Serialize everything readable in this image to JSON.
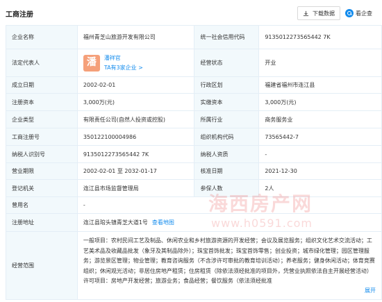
{
  "header": {
    "title": "工商注册",
    "download_label": "下载数据",
    "report_label": "看企查"
  },
  "fields": {
    "company_name": {
      "label": "企业名称",
      "value": "福州青芝山旅游开发有限公司"
    },
    "credit_code": {
      "label": "统一社会信用代码",
      "value": "9135012273565442 7K"
    },
    "legal_rep": {
      "label": "法定代表人",
      "avatar_char": "潘",
      "name": "潘祥官",
      "tag": "TA有3家企业 >"
    },
    "status": {
      "label": "经营状态",
      "value": "开业"
    },
    "found_date": {
      "label": "成立日期",
      "value": "2002-02-01"
    },
    "region": {
      "label": "行政区划",
      "value": "福建省福州市连江县"
    },
    "reg_capital": {
      "label": "注册资本",
      "value": "3,000万(元)"
    },
    "paid_capital": {
      "label": "实缴资本",
      "value": "3,000万(元)"
    },
    "company_type": {
      "label": "企业类型",
      "value": "有限责任公司(自然人投资或控股)"
    },
    "industry": {
      "label": "所属行业",
      "value": "商务服务业"
    },
    "reg_no": {
      "label": "工商注册号",
      "value": "350122100004986"
    },
    "org_code": {
      "label": "组织机构代码",
      "value": "73565442-7"
    },
    "taxpayer_id": {
      "label": "纳税人识别号",
      "value": "9135012273565442 7K"
    },
    "taxpayer_qual": {
      "label": "纳税人资质",
      "value": "-"
    },
    "biz_term": {
      "label": "营业期限",
      "value": "2002-02-01 至 2032-01-17"
    },
    "approval_date": {
      "label": "核准日期",
      "value": "2021-12-30"
    },
    "reg_authority": {
      "label": "登记机关",
      "value": "连江县市场监督管理局"
    },
    "insured": {
      "label": "参保人数",
      "value": "2人"
    },
    "former_name": {
      "label": "曾用名",
      "value": "-"
    },
    "address": {
      "label": "注册地址",
      "value": "连江县琯头镇青芝大道1号",
      "map_link": "查看地图"
    },
    "scope": {
      "label": "经营范围",
      "value": "一般项目：农村民间工艺及制品、休闲农业和乡村旅游资源的开发经营；会议及展览服务；组织文化艺术交流活动；工艺美术品及收藏品批发（象牙及其制品除外）；珠宝首饰批发；珠宝首饰零售；创业投资；城市绿化管理；园区管理服务；游览景区管理；物业管理；教育咨询服务（不含涉许可审批的教育培训活动）；养老服务；健身休闲活动；体育竞赛组织；休闲观光活动；非居住房地产租赁；住房租赁（除依法须经批准的项目外，凭营业执照依法自主开展经营活动）许可项目：房地产开发经营；旅游业务；食品经营；餐饮服务（依法须经批准",
      "expand_label": "展开"
    }
  },
  "watermark": {
    "big": "海西房产网",
    "small": "www.h0591.com"
  }
}
